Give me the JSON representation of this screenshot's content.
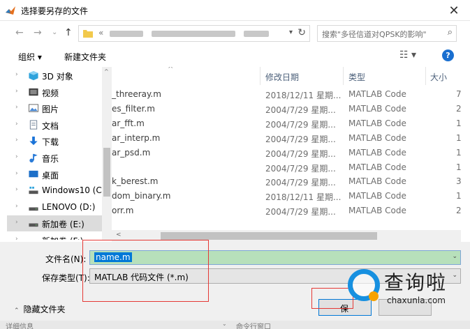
{
  "window": {
    "title": "选择要另存的文件",
    "close_glyph": "✕"
  },
  "nav": {
    "back_glyph": "←",
    "forward_glyph": "→",
    "recent_glyph": "⌄",
    "up_glyph": "↑",
    "address_prefix": "«",
    "address_dropdown": "▾",
    "refresh_glyph": "↻",
    "search_placeholder": "搜索\"多径信道对QPSK的影响\"",
    "search_glyph": "⌕"
  },
  "toolbar": {
    "organize_label": "组织 ▾",
    "new_folder_label": "新建文件夹",
    "view_glyph": "☷ ▾",
    "help_glyph": "?"
  },
  "sidebar": {
    "items": [
      {
        "label": "3D 对象",
        "icon": "cube-icon",
        "color": "#2fa3dc"
      },
      {
        "label": "视频",
        "icon": "video-icon",
        "color": "#3b3b3b"
      },
      {
        "label": "图片",
        "icon": "pictures-icon",
        "color": "#4a8ad6"
      },
      {
        "label": "文档",
        "icon": "documents-icon",
        "color": "#6b7d93"
      },
      {
        "label": "下载",
        "icon": "download-icon",
        "color": "#1a73d8"
      },
      {
        "label": "音乐",
        "icon": "music-icon",
        "color": "#2a7bd8"
      },
      {
        "label": "桌面",
        "icon": "desktop-icon",
        "color": "#1d6fc8"
      },
      {
        "label": "Windows10 (C:",
        "icon": "os-drive-icon",
        "color": "#555555"
      },
      {
        "label": "LENOVO (D:)",
        "icon": "drive-icon",
        "color": "#555555"
      },
      {
        "label": "新加卷 (E:)",
        "icon": "drive-icon",
        "color": "#555555"
      },
      {
        "label": "新加卷 (F:)",
        "icon": "drive-icon",
        "color": "#555555"
      }
    ],
    "selected_index": 9,
    "chevron": "›"
  },
  "files": {
    "sort_glyph": "^",
    "headers": {
      "date": "修改日期",
      "type": "类型",
      "size": "大小"
    },
    "rows": [
      {
        "name": "_threeray.m",
        "date": "2018/12/11 星期...",
        "type": "MATLAB Code",
        "size": "7"
      },
      {
        "name": "es_filter.m",
        "date": "2004/7/29 星期...",
        "type": "MATLAB Code",
        "size": "2"
      },
      {
        "name": "ar_fft.m",
        "date": "2004/7/29 星期...",
        "type": "MATLAB Code",
        "size": "1"
      },
      {
        "name": "ar_interp.m",
        "date": "2004/7/29 星期...",
        "type": "MATLAB Code",
        "size": "1"
      },
      {
        "name": "ar_psd.m",
        "date": "2004/7/29 星期...",
        "type": "MATLAB Code",
        "size": "1"
      },
      {
        "name": "",
        "date": "2004/7/29 星期...",
        "type": "MATLAB Code",
        "size": "1"
      },
      {
        "name": "k_berest.m",
        "date": "2004/7/29 星期...",
        "type": "MATLAB Code",
        "size": "3"
      },
      {
        "name": "dom_binary.m",
        "date": "2018/12/11 星期...",
        "type": "MATLAB Code",
        "size": "1"
      },
      {
        "name": "orr.m",
        "date": "2004/7/29 星期...",
        "type": "MATLAB Code",
        "size": "2"
      }
    ]
  },
  "scroll": {
    "left_glyph": "<",
    "up_glyph": "^"
  },
  "form": {
    "filename_label": "文件名(N):",
    "filename_value": "name.m",
    "filetype_label": "保存类型(T):",
    "filetype_value": "MATLAB 代码文件 (*.m)",
    "dropdown_glyph": "⌄"
  },
  "bottom": {
    "hide_folders_chevron": "⌃",
    "hide_folders_label": "隐藏文件夹",
    "save_label": "保",
    "cancel_label": "",
    "status_left": "详细信息",
    "status_right_chevron": "⌄",
    "status_right": "命令行窗口"
  },
  "watermark": {
    "cn": "查询啦",
    "en": "chaxunla.com",
    "ring_color": "#1790e0",
    "dot_color": "#f7a200"
  }
}
